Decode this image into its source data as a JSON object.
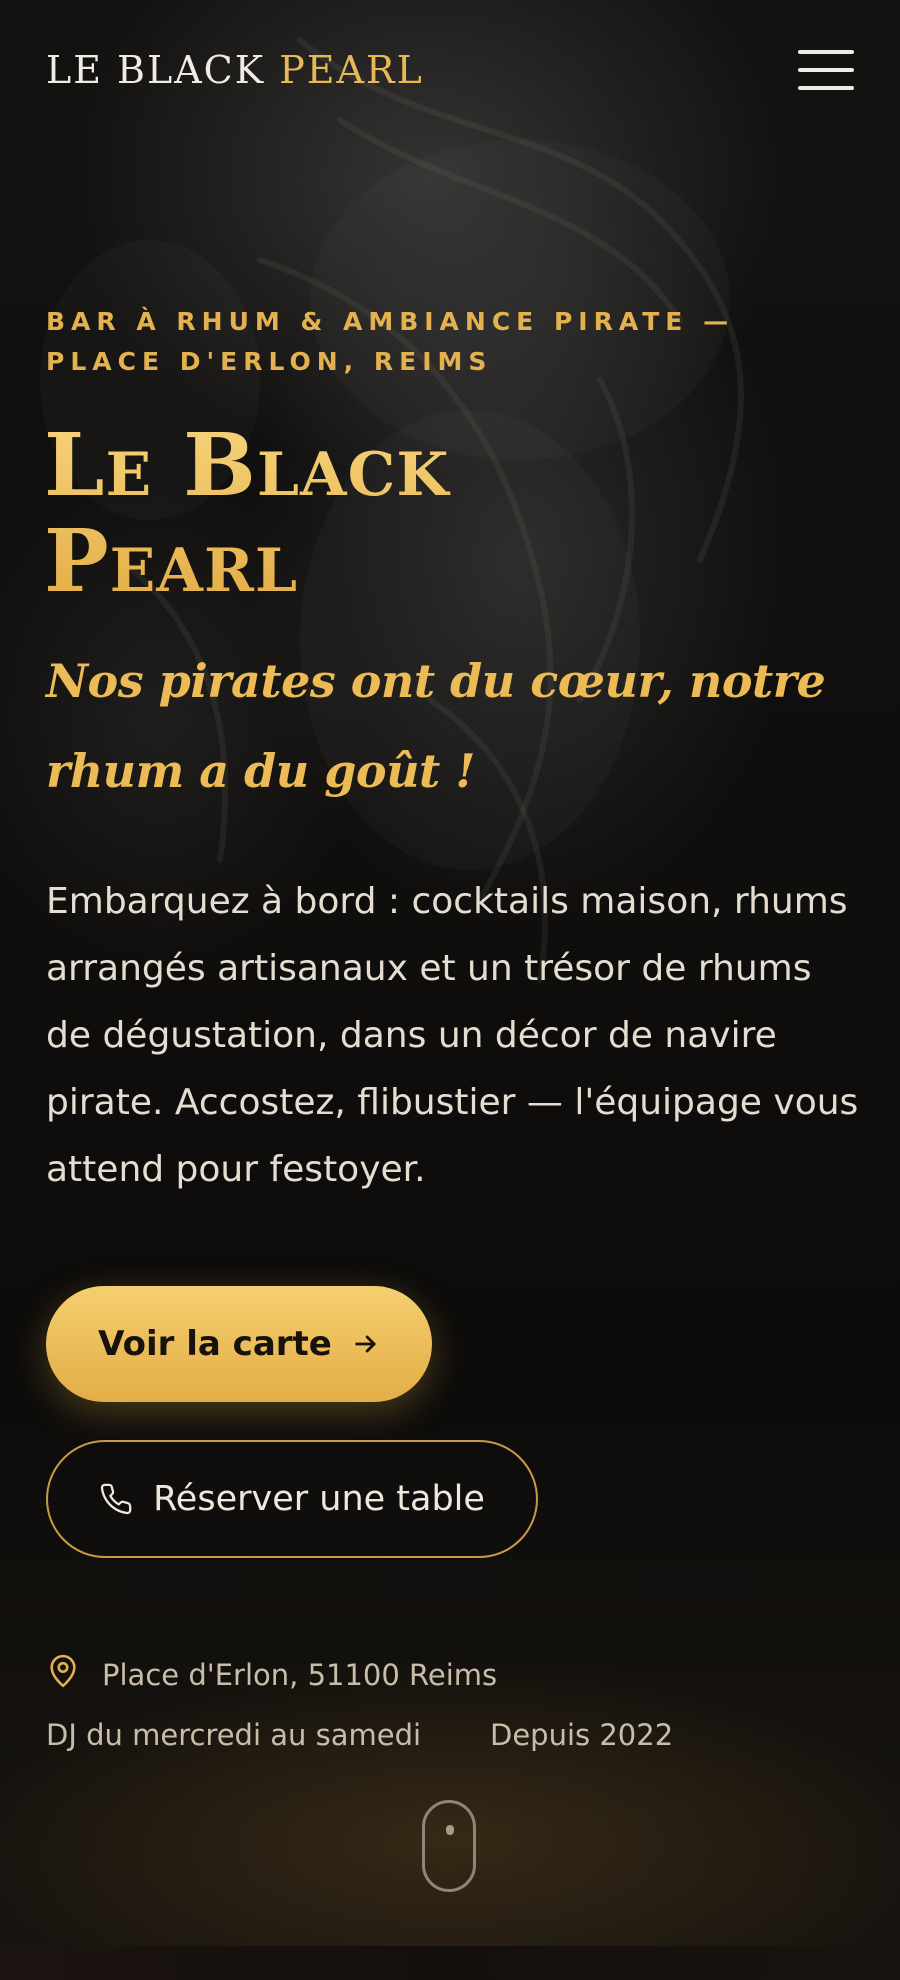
{
  "header": {
    "brand_part1": "LE BLACK",
    "brand_part2": "PEARL",
    "menu_icon": "hamburger-menu-icon"
  },
  "hero": {
    "eyebrow_line1": "BAR À RHUM & AMBIANCE PIRATE —",
    "eyebrow_line2": "PLACE D'ERLON, REIMS",
    "title_line1": "Le Black",
    "title_line2": "Pearl",
    "tagline": "Nos pirates ont du cœur, notre rhum a du goût !",
    "lead": "Embarquez à bord : cocktails maison, rhums arrangés artisanaux et un trésor de rhums de dégustation, dans un décor de navire pirate. Accostez, flibustier — l'équipage vous attend pour festoyer."
  },
  "actions": {
    "primary_label": "Voir la carte",
    "primary_icon": "arrow-right-icon",
    "secondary_label": "Réserver une table",
    "secondary_icon": "phone-icon"
  },
  "info": {
    "address": "Place d'Erlon, 51100 Reims",
    "address_icon": "map-pin-icon",
    "dj": "DJ du mercredi au samedi",
    "since": "Depuis 2022"
  },
  "scroll": {
    "icon": "scroll-mouse-icon"
  },
  "colors": {
    "accent_gold": "#e6b856",
    "background": "#0f0e0d",
    "text_light": "#e5ddcf"
  }
}
